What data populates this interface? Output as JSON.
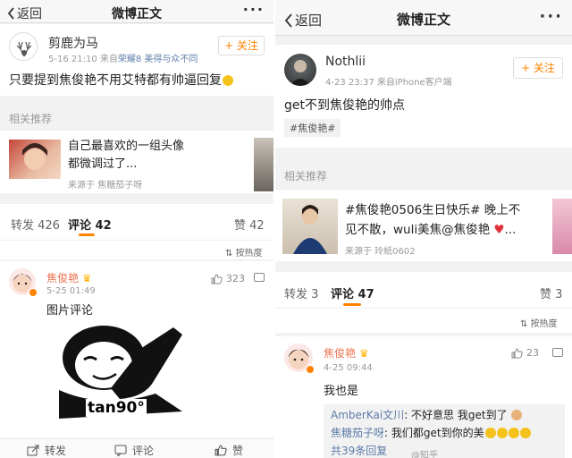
{
  "left": {
    "nav": {
      "back_label": "返回",
      "title": "微博正文",
      "more": "···"
    },
    "post": {
      "username": "剪鹿为马",
      "time": "5-16 21:10",
      "source_prefix": "来自",
      "source": "荣耀8 美得与众不同",
      "follow_label": "+ 关注",
      "text": "只要提到焦俊艳不用艾特都有帅逼回复"
    },
    "related": {
      "label": "相关推荐",
      "text_line1": "自己最喜欢的一组头像",
      "text_line2": "都微调过了...",
      "source": "来源于 焦糖茄子呀"
    },
    "tabs": {
      "repost": "转发 426",
      "comment": "评论 42",
      "like": "赞 42",
      "sort": "按热度"
    },
    "comment": {
      "username": "焦俊艳",
      "time": "5-25 01:49",
      "likes": "323",
      "text": "图片评论",
      "meme_caption": "tan90°"
    },
    "bottom": {
      "repost": "转发",
      "comment": "评论",
      "like": "赞"
    }
  },
  "right": {
    "nav": {
      "back_label": "返回",
      "title": "微博正文",
      "more": "···"
    },
    "post": {
      "username": "Nothlii",
      "time": "4-23 23:37",
      "source_prefix": "来自",
      "source": "iPhone客户端",
      "follow_label": "+ 关注",
      "text": "get不到焦俊艳的帅点",
      "hashtag": "#焦俊艳#"
    },
    "related": {
      "label": "相关推荐",
      "text_line1": "#焦俊艳0506生日快乐# 晚上不",
      "text_line2": "见不散，wuli美焦@焦俊艳",
      "source": "来源于 玲紙0602"
    },
    "tabs": {
      "repost": "转发 3",
      "comment": "评论 47",
      "like": "赞 3",
      "sort": "按热度"
    },
    "comment": {
      "username": "焦俊艳",
      "time": "4-25 09:44",
      "likes": "23",
      "text": "我也是",
      "replies": [
        {
          "name": "AmberKai文川",
          "text": ": 不好意思 我get到了"
        },
        {
          "name": "焦糖茄子呀",
          "text": ": 我们都get到你的美"
        }
      ],
      "more_replies": "共39条回复"
    },
    "watermark": "@知乎"
  },
  "colors": {
    "accent": "#ff8200",
    "link": "#5d7ca8",
    "bg": "#f2f2f2"
  }
}
